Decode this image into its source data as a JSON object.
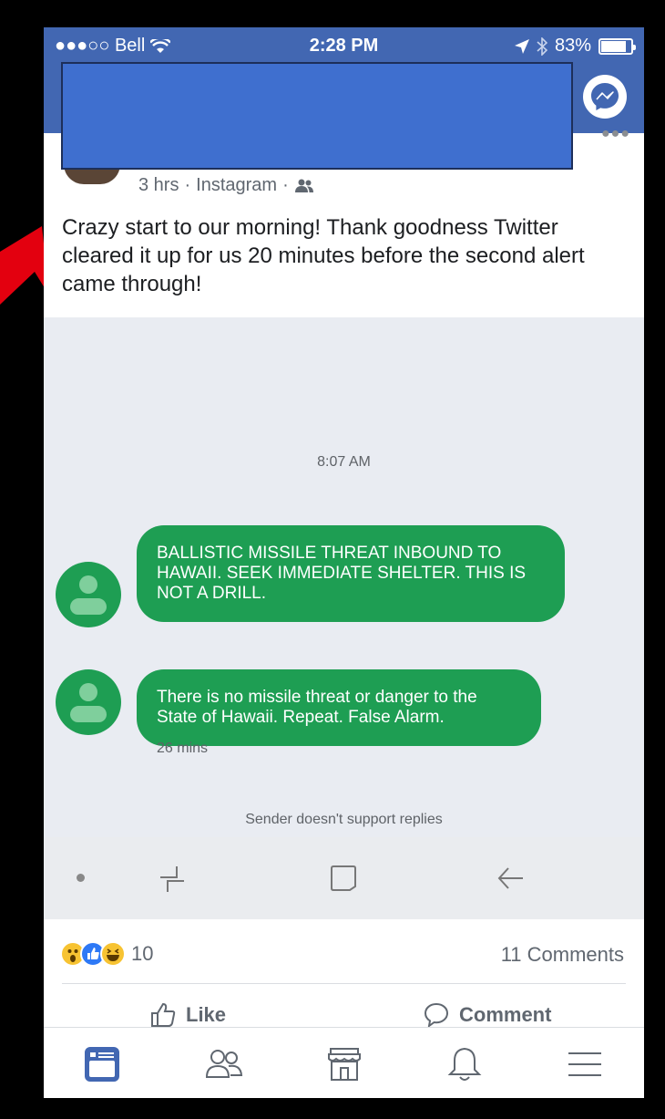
{
  "status_bar": {
    "carrier": "●●●○○ Bell",
    "time": "2:28 PM",
    "battery": "83%",
    "battery_level": 0.83
  },
  "post": {
    "meta_time": "3 hrs",
    "meta_source": "Instagram",
    "separator": "·",
    "text": "Crazy start to our morning!  Thank goodness Twitter cleared it up for us 20 minutes before the second alert came through!"
  },
  "screenshot": {
    "time_label": "8:07 AM",
    "messages": [
      {
        "text": "BALLISTIC MISSILE THREAT INBOUND TO HAWAII. SEEK IMMEDIATE SHELTER. THIS IS NOT A DRILL."
      },
      {
        "text": "There is no missile threat or danger to the State of Hawaii. Repeat. False Alarm."
      }
    ],
    "age_label": "26 mins",
    "footer": "Sender doesn't support replies"
  },
  "reactions": {
    "count": "10",
    "comments": "11 Comments"
  },
  "actions": {
    "like": "Like",
    "comment": "Comment"
  },
  "colors": {
    "facebook_blue": "#4267b2",
    "sms_green": "#1e9e53",
    "alert_red": "#e3000f"
  }
}
